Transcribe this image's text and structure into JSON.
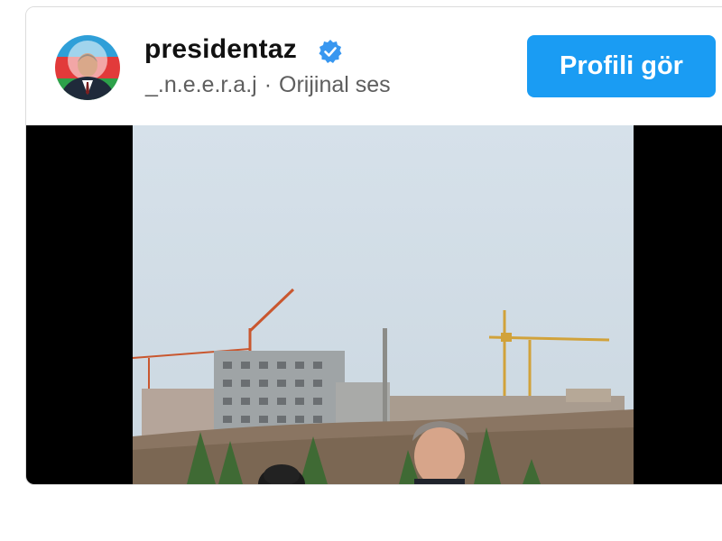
{
  "post": {
    "username": "presidentaz",
    "audio_user": "_.n.e.e.r.a.j",
    "separator": "·",
    "audio_label": "Orijinal ses",
    "view_profile_label": "Profili gör",
    "verified": true
  },
  "colors": {
    "button": "#1a9cf3",
    "verified_badge": "#3897f0",
    "video_background": "#000000"
  },
  "icons": {
    "verified": "verified-badge-icon",
    "avatar": "profile-avatar"
  }
}
